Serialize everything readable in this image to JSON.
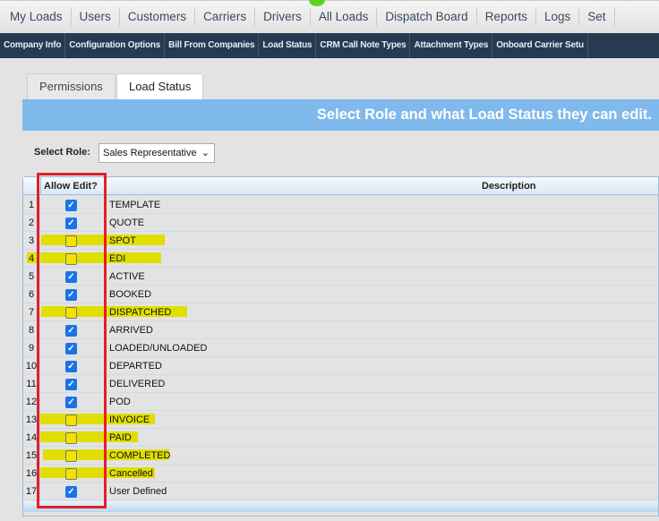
{
  "nav": [
    "My Loads",
    "Users",
    "Customers",
    "Carriers",
    "Drivers",
    "All Loads",
    "Dispatch Board",
    "Reports",
    "Logs",
    "Set"
  ],
  "subnav": [
    "Company Info",
    "Configuration Options",
    "Bill From Companies",
    "Load Status",
    "CRM Call Note Types",
    "Attachment Types",
    "Onboard Carrier Setu"
  ],
  "tabs": {
    "permissions": "Permissions",
    "load_status": "Load Status"
  },
  "banner": "Select Role and what Load Status they can edit.",
  "role": {
    "label": "Select Role:",
    "value": "Sales Representative"
  },
  "table": {
    "headers": {
      "allow": "Allow Edit?",
      "desc": "Description"
    },
    "rows": [
      {
        "n": "1",
        "d": "TEMPLATE",
        "c": true
      },
      {
        "n": "2",
        "d": "QUOTE",
        "c": true
      },
      {
        "n": "3",
        "d": "SPOT",
        "c": false
      },
      {
        "n": "4",
        "d": "EDI",
        "c": false
      },
      {
        "n": "5",
        "d": "ACTIVE",
        "c": true
      },
      {
        "n": "6",
        "d": "BOOKED",
        "c": true
      },
      {
        "n": "7",
        "d": "DISPATCHED",
        "c": false
      },
      {
        "n": "8",
        "d": "ARRIVED",
        "c": true
      },
      {
        "n": "9",
        "d": "LOADED/UNLOADED",
        "c": true
      },
      {
        "n": "10",
        "d": "DEPARTED",
        "c": true
      },
      {
        "n": "11",
        "d": "DELIVERED",
        "c": true
      },
      {
        "n": "12",
        "d": "POD",
        "c": true
      },
      {
        "n": "13",
        "d": "INVOICE",
        "c": false
      },
      {
        "n": "14",
        "d": "PAID",
        "c": false
      },
      {
        "n": "15",
        "d": "COMPLETED",
        "c": false
      },
      {
        "n": "16",
        "d": "Cancelled",
        "c": false
      },
      {
        "n": "17",
        "d": "User Defined",
        "c": true
      }
    ]
  },
  "colors": {
    "highlight": "#e0df00",
    "accent": "#1a73e8",
    "outline": "#e0202a"
  }
}
